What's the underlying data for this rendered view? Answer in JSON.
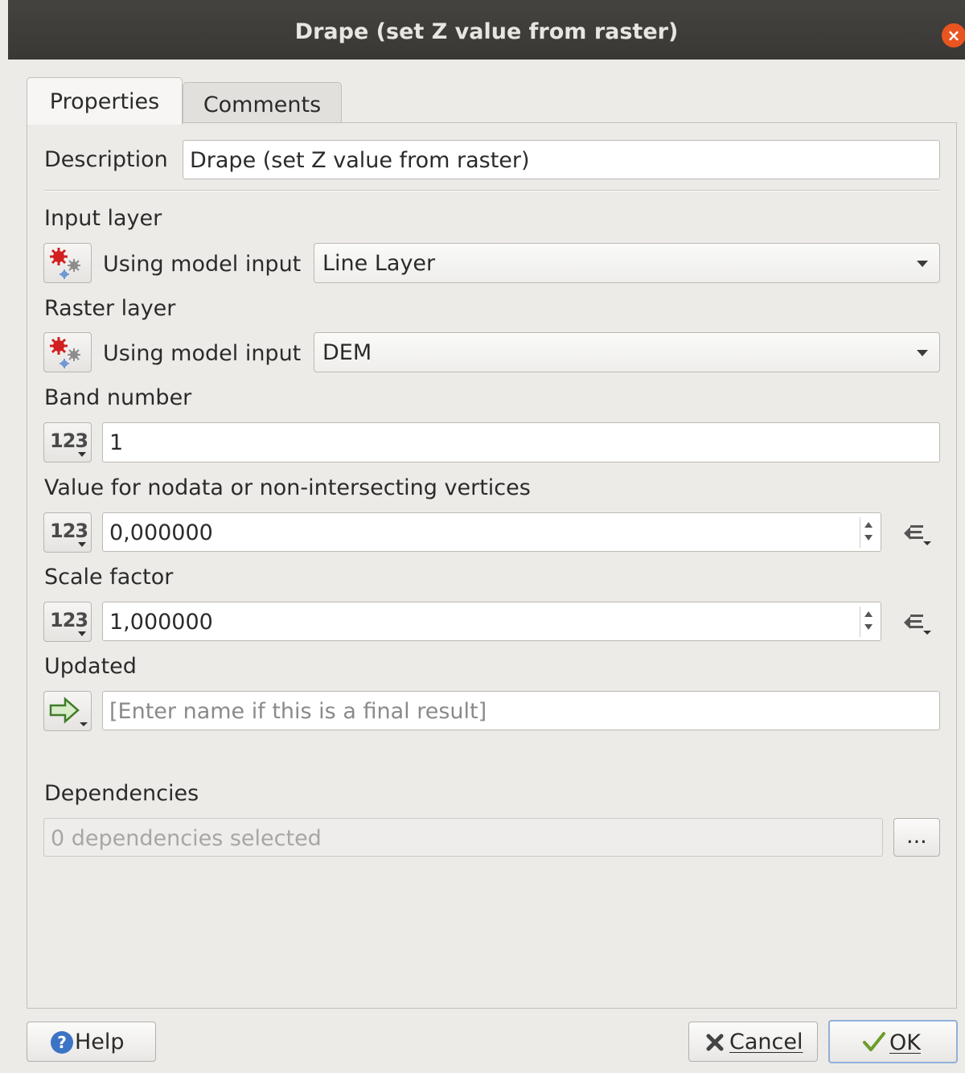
{
  "window": {
    "title": "Drape (set Z value from raster)",
    "close_glyph": "×"
  },
  "tabs": [
    {
      "label": "Properties"
    },
    {
      "label": "Comments"
    }
  ],
  "description": {
    "label": "Description",
    "value": "Drape (set Z value from raster)"
  },
  "input_layer": {
    "label": "Input layer",
    "source_label": "Using model input",
    "value": "Line Layer"
  },
  "raster_layer": {
    "label": "Raster layer",
    "source_label": "Using model input",
    "value": "DEM"
  },
  "band_number": {
    "label": "Band number",
    "icon_text": "123",
    "value": "1"
  },
  "nodata_value": {
    "label": "Value for nodata or non-intersecting vertices",
    "icon_text": "123",
    "value": "0,000000"
  },
  "scale_factor": {
    "label": "Scale factor",
    "icon_text": "123",
    "value": "1,000000"
  },
  "updated": {
    "label": "Updated",
    "placeholder": "[Enter name if this is a final result]"
  },
  "dependencies": {
    "label": "Dependencies",
    "value": "0 dependencies selected",
    "button": "..."
  },
  "footer": {
    "help": "Help",
    "cancel": "Cancel",
    "ok": "OK"
  },
  "colors": {
    "accent_close": "#e95420",
    "titlebar": "#3f3d3a",
    "help_icon": "#3b74c4",
    "ok_check": "#6b9e2b"
  }
}
